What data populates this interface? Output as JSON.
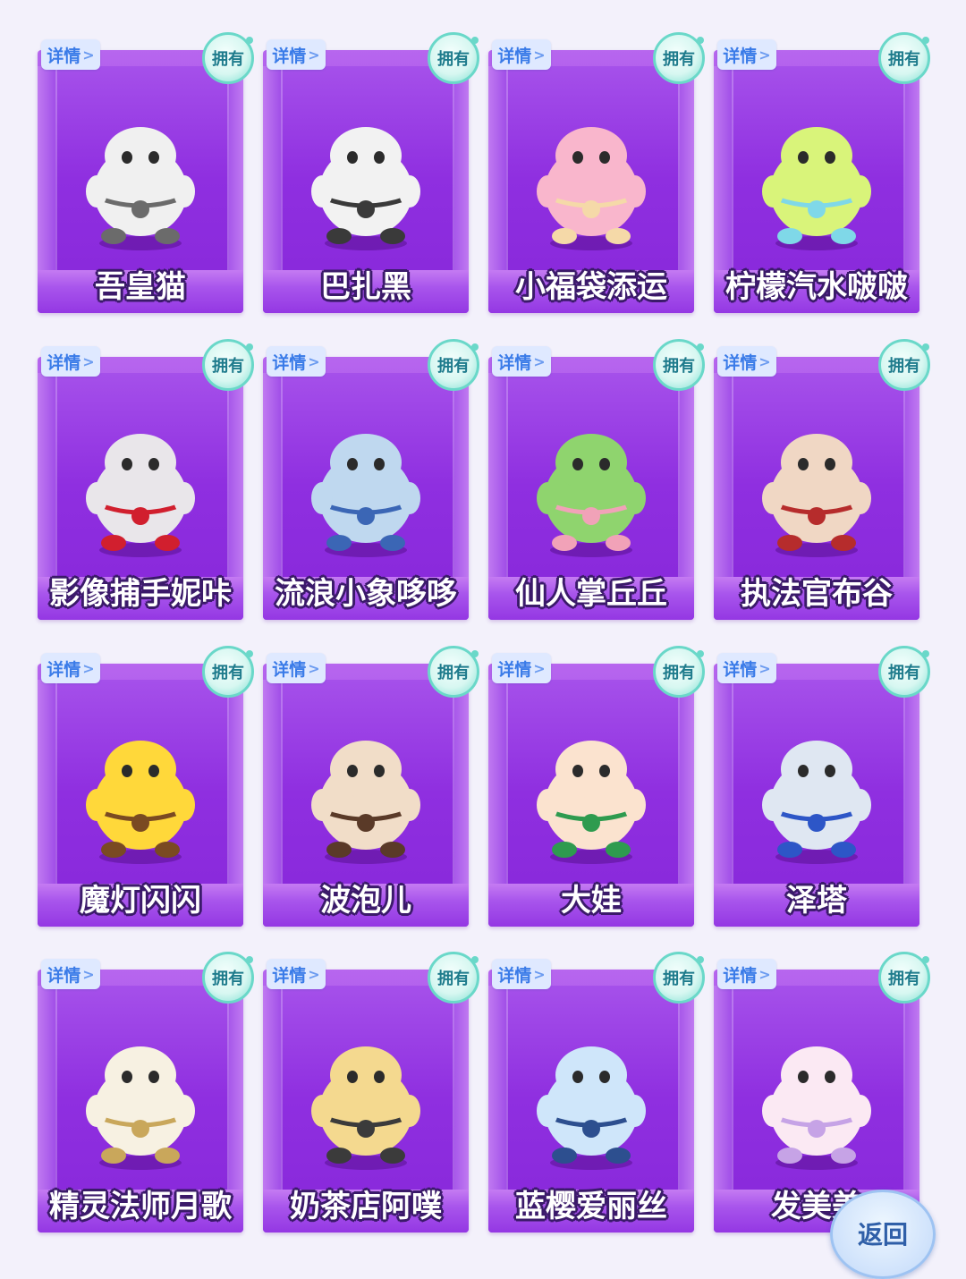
{
  "detail_label": "详情",
  "detail_chevron": ">",
  "owned_label": "拥有",
  "back_label": "返回",
  "cards": [
    {
      "name": "吾皇猫",
      "body": "#f0f0f0",
      "accent": "#6b6b6b",
      "icon": "cat-figure-icon"
    },
    {
      "name": "巴扎黑",
      "body": "#f2f2f2",
      "accent": "#3a3a3a",
      "icon": "pug-figure-icon"
    },
    {
      "name": "小福袋添运",
      "body": "#f9b6cc",
      "accent": "#f5d9a8",
      "icon": "lucky-bag-figure-icon"
    },
    {
      "name": "柠檬汽水啵啵",
      "body": "#d9f47a",
      "accent": "#7fd8e8",
      "icon": "lemon-soda-figure-icon"
    },
    {
      "name": "影像捕手妮咔",
      "body": "#e9e6ea",
      "accent": "#d11f2e",
      "icon": "camera-girl-figure-icon"
    },
    {
      "name": "流浪小象哆哆",
      "body": "#bfd8ef",
      "accent": "#3b66b5",
      "icon": "elephant-figure-icon"
    },
    {
      "name": "仙人掌丘丘",
      "body": "#8fd46e",
      "accent": "#f1a2b8",
      "icon": "cactus-figure-icon"
    },
    {
      "name": "执法官布谷",
      "body": "#f0d7c4",
      "accent": "#b62c2c",
      "icon": "officer-figure-icon"
    },
    {
      "name": "魔灯闪闪",
      "body": "#ffd83a",
      "accent": "#7a4a22",
      "icon": "lantern-figure-icon"
    },
    {
      "name": "波泡儿",
      "body": "#f1ddc8",
      "accent": "#5a3a28",
      "icon": "pirate-dog-figure-icon"
    },
    {
      "name": "大娃",
      "body": "#fbe3cf",
      "accent": "#2e9b4f",
      "icon": "calabash-boy-figure-icon"
    },
    {
      "name": "泽塔",
      "body": "#dfe7f2",
      "accent": "#2d56c7",
      "icon": "hero-figure-icon"
    },
    {
      "name": "精灵法师月歌",
      "body": "#f7f1e2",
      "accent": "#c9a75b",
      "icon": "elf-mage-figure-icon"
    },
    {
      "name": "奶茶店阿噗",
      "body": "#f4d98f",
      "accent": "#3b3b3b",
      "icon": "milk-tea-figure-icon"
    },
    {
      "name": "蓝樱爱丽丝",
      "body": "#cfe6fa",
      "accent": "#2d4f8f",
      "icon": "alice-figure-icon"
    },
    {
      "name": "发美美",
      "body": "#fbe9f3",
      "accent": "#c6a3e6",
      "icon": "fluffy-figure-icon"
    }
  ]
}
